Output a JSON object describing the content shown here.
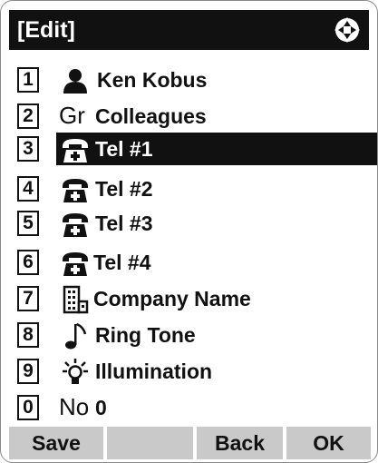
{
  "title": "[Edit]",
  "items": [
    {
      "num": "1",
      "icon": "person-icon",
      "label": "Ken Kobus"
    },
    {
      "num": "2",
      "icon": "group-icon",
      "icon_text": "Gr",
      "label": "Colleagues"
    },
    {
      "num": "3",
      "icon": "telephone-icon",
      "label": "Tel #1",
      "selected": true
    },
    {
      "num": "4",
      "icon": "telephone-icon",
      "label": "Tel #2"
    },
    {
      "num": "5",
      "icon": "telephone-icon",
      "label": "Tel #3"
    },
    {
      "num": "6",
      "icon": "telephone-icon",
      "label": "Tel #4"
    },
    {
      "num": "7",
      "icon": "company-building-icon",
      "label": "Company Name"
    },
    {
      "num": "8",
      "icon": "music-note-icon",
      "label": "Ring Tone"
    },
    {
      "num": "9",
      "icon": "light-bulb-icon",
      "label": "Illumination"
    },
    {
      "num": "0",
      "icon": "number-icon",
      "icon_text": "No",
      "label": "0"
    }
  ],
  "softkeys": [
    "Save",
    "",
    "Back",
    "OK"
  ],
  "colors": {
    "title_bg": "#111111",
    "selection_bg": "#111111",
    "softkey_bg": "#c9c9c9"
  }
}
